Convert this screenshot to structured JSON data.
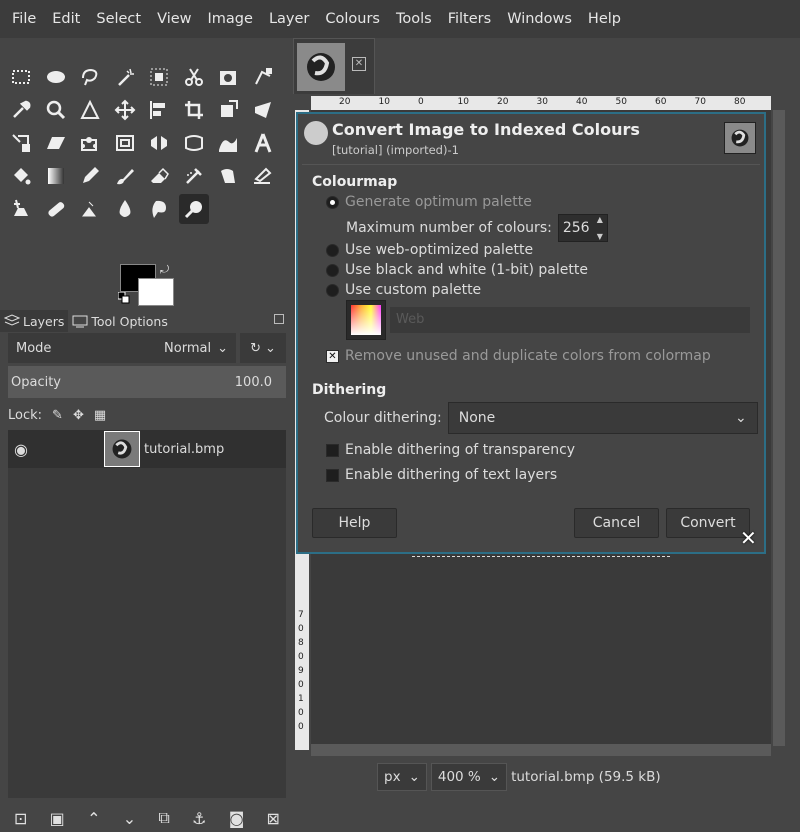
{
  "menubar": [
    "File",
    "Edit",
    "Select",
    "View",
    "Image",
    "Layer",
    "Colours",
    "Tools",
    "Filters",
    "Windows",
    "Help"
  ],
  "dock": {
    "tabs": [
      {
        "label": "Layers",
        "icon": "layers-icon"
      },
      {
        "label": "Tool Options",
        "icon": "tool-options-icon"
      }
    ],
    "mode_label": "Mode",
    "mode_value": "Normal",
    "opacity_label": "Opacity",
    "opacity_value": "100.0",
    "lock_label": "Lock:",
    "layer_name": "tutorial.bmp"
  },
  "status": {
    "unit": "px",
    "zoom": "400 %",
    "file_info": "tutorial.bmp (59.5 kB)"
  },
  "rulers": {
    "h_ticks": [
      "20",
      "10",
      "0",
      "10",
      "20",
      "30",
      "40",
      "50",
      "60",
      "70",
      "80"
    ],
    "v_ticks": [
      "7",
      "0",
      "8",
      "0",
      "9",
      "0",
      "1",
      "0",
      "0"
    ]
  },
  "dialog": {
    "title": "Convert Image to Indexed Colours",
    "subtitle": "[tutorial] (imported)-1",
    "colourmap_heading": "Colourmap",
    "opt_generate": "Generate optimum palette",
    "max_colours_label": "Maximum number of colours:",
    "max_colours_value": "256",
    "opt_web": "Use web-optimized palette",
    "opt_bw": "Use black and white (1-bit) palette",
    "opt_custom": "Use custom palette",
    "custom_palette_name": "Web",
    "remove_unused": "Remove unused and duplicate colors from colormap",
    "dithering_heading": "Dithering",
    "colour_dithering_label": "Colour dithering:",
    "colour_dithering_value": "None",
    "dither_transparency": "Enable dithering of transparency",
    "dither_text": "Enable dithering of text layers",
    "help_button": "Help",
    "cancel_button": "Cancel",
    "convert_button": "Convert"
  }
}
